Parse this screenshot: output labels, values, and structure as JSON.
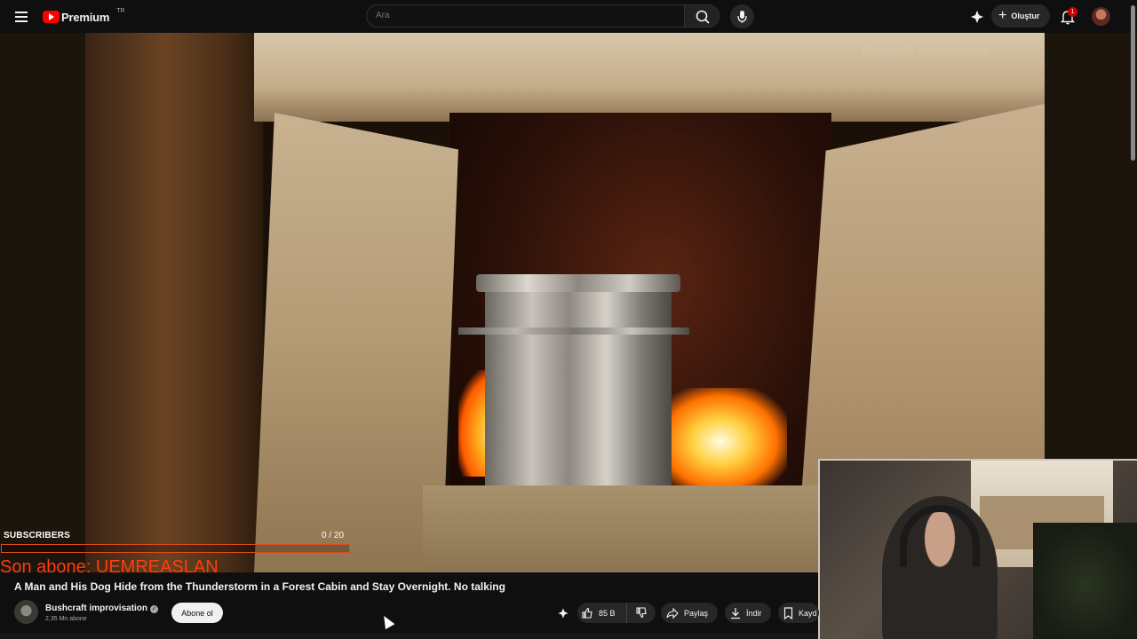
{
  "header": {
    "logo_text": "Premium",
    "logo_region": "TR",
    "search_placeholder": "Ara",
    "create_label": "Oluştur",
    "notification_count": "1"
  },
  "video": {
    "watermark": "Bushcraft improvisation"
  },
  "overlay": {
    "subscribers_label": "SUBSCRIBERS",
    "subscribers_count": "0 / 20",
    "subscribers_progress": 0,
    "last_subscriber": "Son abone: UEMREASLAN"
  },
  "details": {
    "title": "A Man and His Dog Hide from the Thunderstorm in a Forest Cabin and Stay Overnight. No talking",
    "channel_name": "Bushcraft improvisation",
    "channel_subscribers": "2,35 Mn abone",
    "subscribe_label": "Abone ol"
  },
  "actions": {
    "likes": "85 B",
    "share_label": "Paylaş",
    "download_label": "İndir",
    "save_label": "Kayd"
  },
  "icons": {
    "menu": "menu-icon",
    "search": "search-icon",
    "mic": "mic-icon",
    "create": "plus-icon",
    "notifications": "bell-icon",
    "like": "thumbs-up-icon",
    "dislike": "thumbs-down-icon",
    "share": "share-arrow-icon",
    "download": "download-icon",
    "save": "bookmark-icon"
  },
  "colors": {
    "brand_red": "#ff0000",
    "overlay_orange": "#ff3d0d",
    "background": "#0f0f0f"
  }
}
